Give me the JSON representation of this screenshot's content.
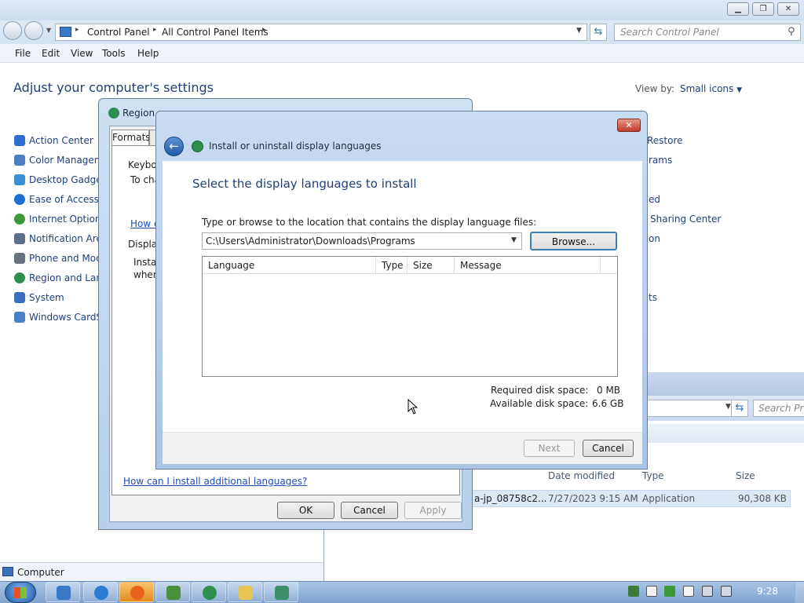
{
  "window": {
    "breadcrumb": [
      "Control Panel",
      "All Control Panel Items"
    ],
    "search_placeholder": "Search Control Panel",
    "menu": [
      "File",
      "Edit",
      "View",
      "Tools",
      "Help"
    ],
    "heading": "Adjust your computer's settings",
    "view_by_label": "View by:",
    "view_by_value": "Small icons",
    "items": [
      {
        "label": "Action Center",
        "color": "#2f6fd0"
      },
      {
        "label": "Color Managemen",
        "color": "#4a7fc1"
      },
      {
        "label": "Desktop Gadgets",
        "color": "#3a8fd6"
      },
      {
        "label": "Ease of Access C",
        "color": "#1e6fd0"
      },
      {
        "label": "Internet Options",
        "color": "#3c9a3c"
      },
      {
        "label": "Notification Area",
        "color": "#5a6f8a"
      },
      {
        "label": "Phone and Mode",
        "color": "#6a7380"
      },
      {
        "label": "Region and Lang",
        "color": "#2f8f4f"
      },
      {
        "label": "System",
        "color": "#3a6fbf"
      },
      {
        "label": "Windows CardSp",
        "color": "#4a80c8"
      }
    ],
    "right_items": [
      "Restore",
      "rams",
      "ed",
      "Sharing Center",
      "on",
      "ts"
    ]
  },
  "bg_explorer": {
    "search_placeholder": "Search Pro",
    "columns": [
      "Date modified",
      "Type",
      "Size"
    ],
    "row": {
      "name": "a-jp_08758c2...",
      "date": "7/27/2023 9:15 AM",
      "type": "Application",
      "size": "90,308 KB"
    },
    "status": "Computer"
  },
  "region_dialog": {
    "title": "Region a",
    "tabs": [
      "Formats"
    ],
    "keyboard_heading": "Keyboa",
    "keyboard_text": "To cha",
    "keyboard_link": "How d",
    "display_heading": "Display",
    "display_text_1": "Install",
    "display_text_2": "where",
    "link": "How can I install additional languages?",
    "buttons": {
      "ok": "OK",
      "cancel": "Cancel",
      "apply": "Apply"
    }
  },
  "install_dialog": {
    "title": "Install or uninstall display languages",
    "heading": "Select the display languages to install",
    "prompt": "Type or browse to the location that contains the display language files:",
    "path": "C:\\Users\\Administrator\\Downloads\\Programs",
    "browse": "Browse...",
    "columns": [
      "Language",
      "Type",
      "Size",
      "Message"
    ],
    "required_label": "Required disk space:",
    "required_value": "0 MB",
    "available_label": "Available disk space:",
    "available_value": "6.6 GB",
    "next": "Next",
    "cancel": "Cancel"
  },
  "taskbar": {
    "clock": "9:28"
  }
}
